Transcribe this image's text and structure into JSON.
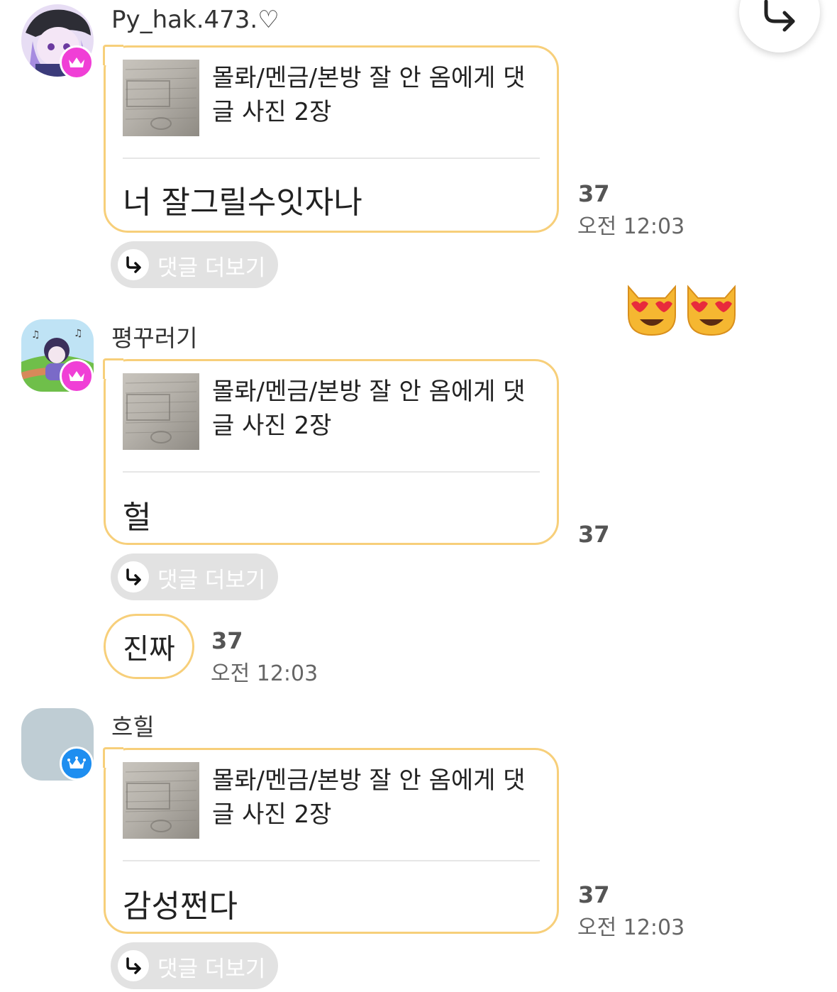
{
  "share_button": {
    "icon": "reply-arrow-icon"
  },
  "reactions": {
    "emoji": "😻😻"
  },
  "comments": [
    {
      "username": "Py_hak.473.♡",
      "quote": "몰롸/멘금/본방 잘 안 옴에게 댓글 사진 2장",
      "text": "너 잘그릴수잇자나",
      "count": "37",
      "time": "오전 12:03",
      "more_label": "댓글 더보기",
      "badge_color": "#f03fd6"
    },
    {
      "username": "평꾸러기",
      "quote": "몰롸/멘금/본방 잘 안 옴에게 댓글 사진 2장",
      "text": "헐",
      "count": "37",
      "more_label": "댓글 더보기",
      "badge_color": "#f03fd6",
      "followup": {
        "text": "진짜",
        "count": "37",
        "time": "오전 12:03"
      }
    },
    {
      "username": "흐힐",
      "quote": "몰롸/멘금/본방 잘 안 옴에게 댓글 사진 2장",
      "text": "감성쩐다",
      "count": "37",
      "time": "오전 12:03",
      "more_label": "댓글 더보기",
      "badge_color": "#1e8ef0"
    }
  ],
  "accent_color": "#f7cf7a"
}
